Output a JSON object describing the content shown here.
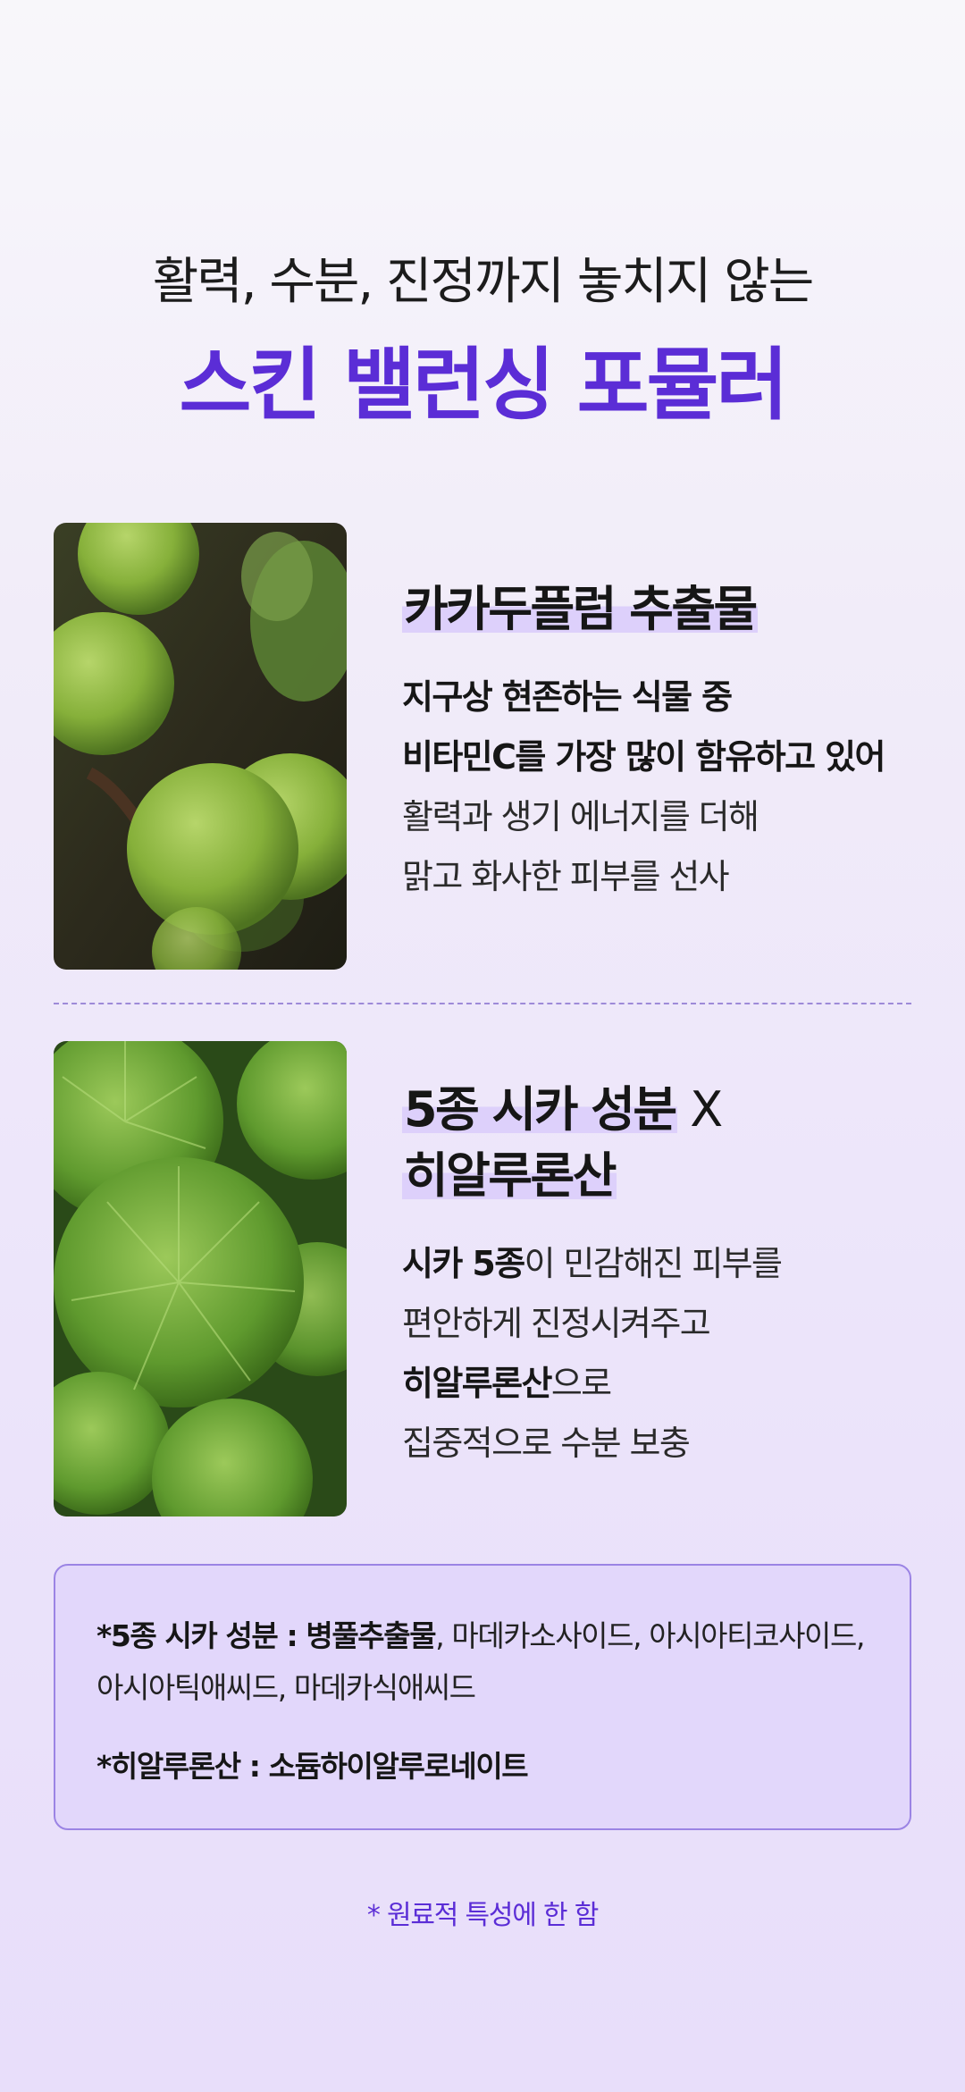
{
  "headline": {
    "sub": "활력, 수분, 진정까지 놓치지 않는",
    "main": "스킨 밸런싱 포뮬러"
  },
  "features": [
    {
      "title": "카카두플럼 추출물",
      "desc": [
        {
          "bold": "지구상 현존하는 식물 중",
          "rest": ""
        },
        {
          "bold": "비타민C를 가장 많이 함유하고 있어",
          "rest": ""
        },
        {
          "bold": "",
          "rest": "활력과 생기 에너지를 더해"
        },
        {
          "bold": "",
          "rest": "맑고 화사한 피부를 선사"
        }
      ]
    },
    {
      "title_line1": "5종 시카 성분",
      "title_x": " X",
      "title_line2": "히알루론산",
      "desc": [
        {
          "bold": "시카 5종",
          "rest": "이 민감해진 피부를"
        },
        {
          "bold": "",
          "rest": "편안하게 진정시켜주고"
        },
        {
          "bold": "히알루론산",
          "rest": "으로"
        },
        {
          "bold": "",
          "rest": "집중적으로 수분 보충"
        }
      ]
    }
  ],
  "notes": {
    "cica_label": "*5종 시카 성분 : ",
    "cica_bold": "병풀추출물",
    "cica_rest": ", 마데카소사이드, 아시아티코사이드,",
    "cica_line2": "아시아틱애씨드, 마데카식애씨드",
    "ha_label": "*히알루론산 : ",
    "ha_value": "소듐하이알루로네이트"
  },
  "footnote": "* 원료적 특성에 한 함",
  "colors": {
    "accent": "#5b2dd6",
    "highlight": "#ddd0fb",
    "box_bg": "#e2d7fb",
    "box_border": "#9b84e4"
  }
}
